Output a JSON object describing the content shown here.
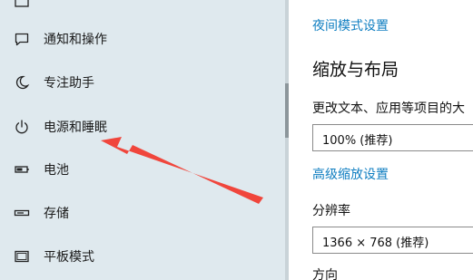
{
  "sidebar": {
    "items": [
      {
        "label": "",
        "icon": "display-icon"
      },
      {
        "label": "通知和操作",
        "icon": "notification-icon"
      },
      {
        "label": "专注助手",
        "icon": "moon-icon"
      },
      {
        "label": "电源和睡眠",
        "icon": "power-icon"
      },
      {
        "label": "电池",
        "icon": "battery-icon"
      },
      {
        "label": "存储",
        "icon": "storage-icon"
      },
      {
        "label": "平板模式",
        "icon": "tablet-icon"
      }
    ]
  },
  "main": {
    "night_mode_link": "夜间模式设置",
    "scale_section_title": "缩放与布局",
    "text_size_label": "更改文本、应用等项目的大",
    "scale_value": "100% (推荐)",
    "advanced_scale_link": "高级缩放设置",
    "resolution_label": "分辨率",
    "resolution_value": "1366 × 768 (推荐)",
    "orientation_label": "方向"
  },
  "colors": {
    "sidebar_bg": "#dfe9ee",
    "link": "#0f7ec1",
    "annotation_arrow": "#f0463c"
  }
}
